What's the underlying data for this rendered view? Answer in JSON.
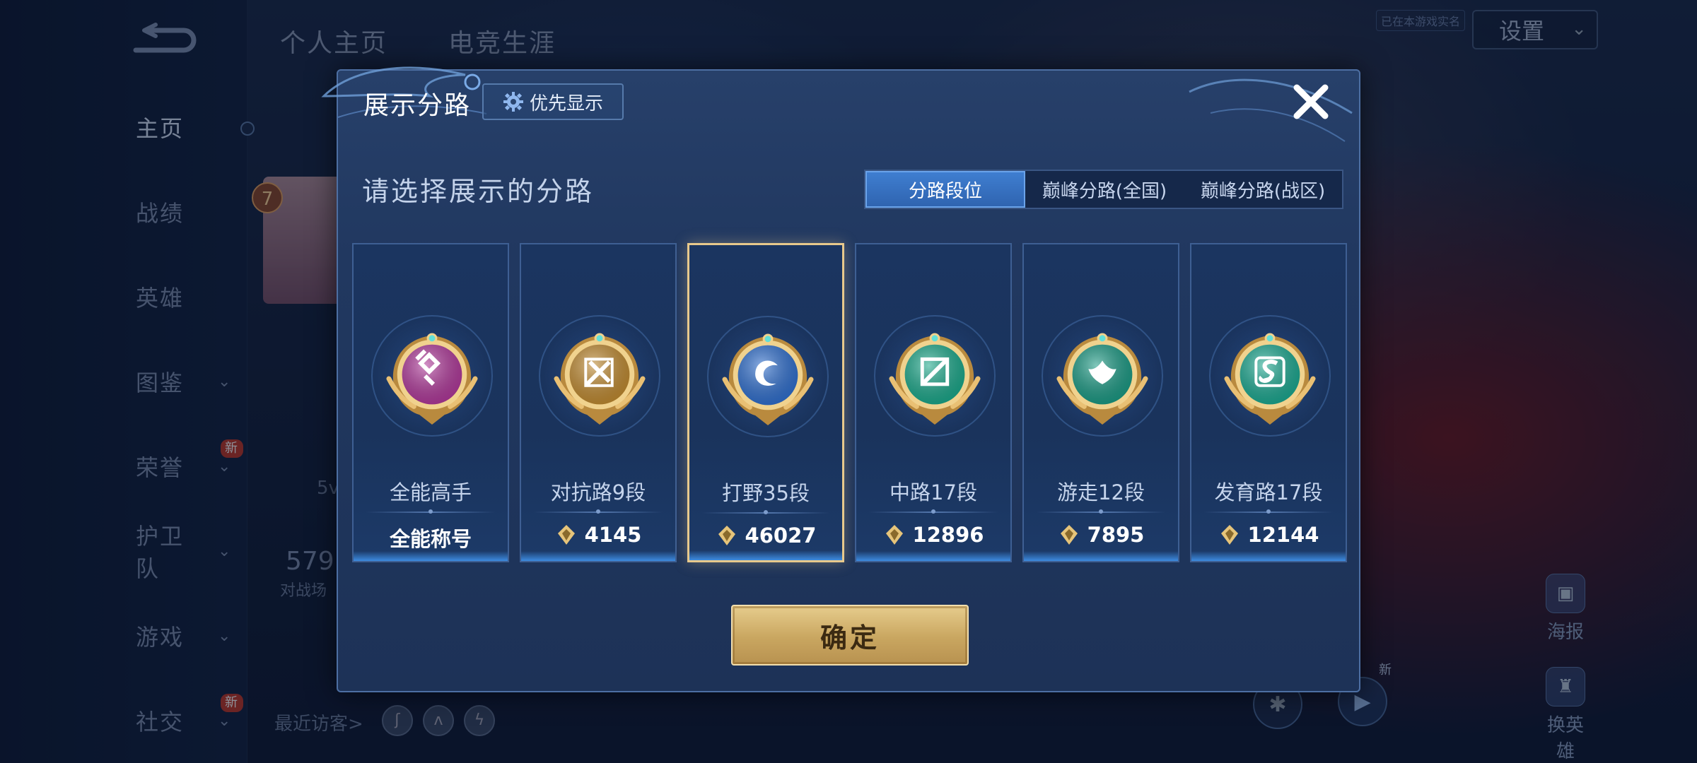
{
  "background": {
    "top_tabs": [
      "个人主页",
      "电竞生涯"
    ],
    "settings_label": "设置",
    "top_hint": "已在本游戏实名",
    "nav": [
      {
        "label": "主页",
        "chevron": false,
        "new": false
      },
      {
        "label": "战绩",
        "chevron": false,
        "new": false
      },
      {
        "label": "英雄",
        "chevron": false,
        "new": false
      },
      {
        "label": "图鉴",
        "chevron": true,
        "new": false
      },
      {
        "label": "荣誉",
        "chevron": true,
        "new": true
      },
      {
        "label": "护卫队",
        "chevron": true,
        "new": false
      },
      {
        "label": "游戏",
        "chevron": true,
        "new": false
      },
      {
        "label": "社交",
        "chevron": true,
        "new": true
      }
    ],
    "new_badge": "新",
    "level": "7",
    "partial_number": "579",
    "partial_sub": "对战场",
    "partial_5": "5v",
    "recent_visitors": "最近访客>",
    "right_buttons": [
      "海报",
      "换英雄"
    ],
    "new_badge_right": "新"
  },
  "modal": {
    "title": "展示分路",
    "priority_label": "优先显示",
    "subtitle": "请选择展示的分路",
    "tabs": [
      "分路段位",
      "巅峰分路(全国)",
      "巅峰分路(战区)"
    ],
    "active_tab": 0,
    "cards": [
      {
        "name": "全能高手",
        "score": "全能称号",
        "has_icon": false,
        "color": "#b0389a",
        "selected": false
      },
      {
        "name": "对抗路9段",
        "score": "4145",
        "has_icon": true,
        "color": "#c08a30",
        "selected": false
      },
      {
        "name": "打野35段",
        "score": "46027",
        "has_icon": true,
        "color": "#2f6fcf",
        "selected": true
      },
      {
        "name": "中路17段",
        "score": "12896",
        "has_icon": true,
        "color": "#1aa88a",
        "selected": false
      },
      {
        "name": "游走12段",
        "score": "7895",
        "has_icon": true,
        "color": "#1a9a84",
        "selected": false
      },
      {
        "name": "发育路17段",
        "score": "12144",
        "has_icon": true,
        "color": "#1aa890",
        "selected": false
      }
    ],
    "confirm_label": "确定"
  },
  "colors": {
    "accent_blue": "#3f7ed0",
    "gold": "#e6cc8c",
    "panel": "#213860"
  }
}
